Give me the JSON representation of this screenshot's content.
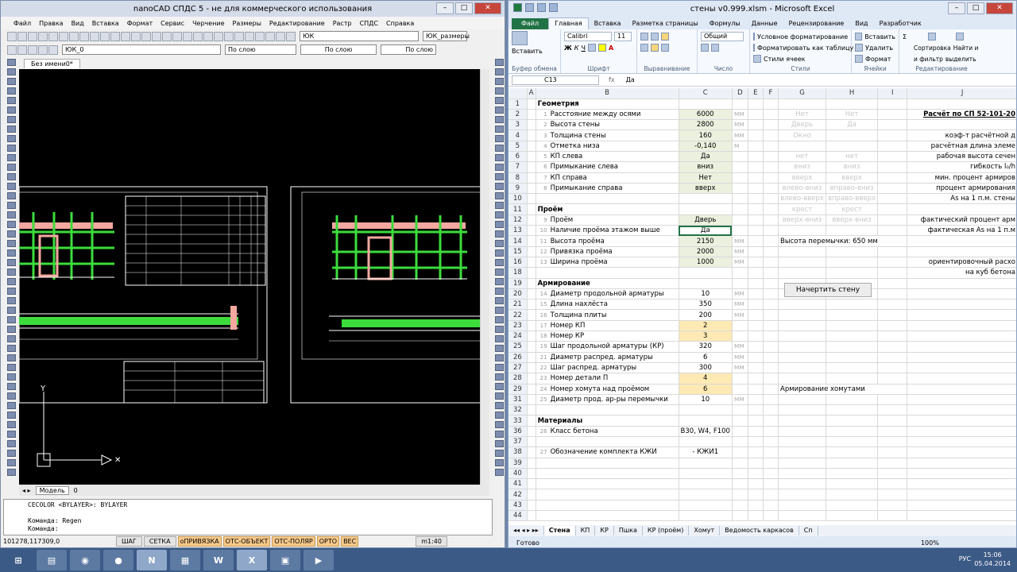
{
  "cad": {
    "title": "nanoCAD СПДС 5 - не для коммерческого использования",
    "menu": [
      "Файл",
      "Правка",
      "Вид",
      "Вставка",
      "Формат",
      "Сервис",
      "Черчение",
      "Размеры",
      "Редактирование",
      "Растр",
      "СПДС",
      "Справка"
    ],
    "combo_layer1": "ЮК",
    "combo_dim": "ЮК_размеры",
    "combo_layer2": "ЮК_0",
    "combo_color": "По слою",
    "combo_ltype": "По слою",
    "combo_lweight": "По слою",
    "doc_tab": "Без имени0*",
    "model_tab": "Модель",
    "sheet_tab": "0",
    "cmd_lines": [
      "CECOLOR <BYLAYER>: BYLAYER",
      "",
      "Команда: Regen",
      "Команда:"
    ],
    "coords": "101278,117309,0",
    "status": [
      "ШАГ",
      "СЕТКА",
      "оПРИВЯЗКА",
      "ОТС-ОБЪЕКТ",
      "ОТС-ПОЛЯР",
      "ОРТО",
      "ВЕС"
    ],
    "scale": "m1:40",
    "axis_y": "Y"
  },
  "excel": {
    "title": "стены v0.999.xlsm - Microsoft Excel",
    "tabs": [
      "Файл",
      "Главная",
      "Вставка",
      "Разметка страницы",
      "Формулы",
      "Данные",
      "Рецензирование",
      "Вид",
      "Разработчик"
    ],
    "ribbon": {
      "paste": "Вставить",
      "clipboard": "Буфер обмена",
      "font_name": "Calibri",
      "font_size": "11",
      "font": "Шрифт",
      "align": "Выравнивание",
      "numfmt": "Общий",
      "number": "Число",
      "cond": "Условное форматирование",
      "astable": "Форматировать как таблицу",
      "cellstyles": "Стили ячеек",
      "styles": "Стили",
      "ins": "Вставить",
      "del": "Удалить",
      "fmt": "Формат",
      "cells": "Ячейки",
      "sort": "Сортировка",
      "sort2": "и фильтр",
      "find": "Найти и",
      "find2": "выделить",
      "edit": "Редактирование"
    },
    "namebox": "C13",
    "fx": "fx",
    "formula": "Да",
    "cols": [
      "",
      "A",
      "B",
      "C",
      "D",
      "E",
      "F",
      "G",
      "H",
      "I",
      "J"
    ],
    "rows": [
      {
        "n": "1",
        "b": "Геометрия",
        "bb": true
      },
      {
        "n": "2",
        "s": "1",
        "b": "Расстояние между осями",
        "c": "6000",
        "cg": true,
        "d": "мм",
        "g": "Нет",
        "h": "Нет",
        "j": "Расчёт по СП 52-101-20",
        "jb": true
      },
      {
        "n": "3",
        "s": "2",
        "b": "Высота стены",
        "c": "2800",
        "cg": true,
        "d": "мм",
        "g": "Дверь",
        "h": "Да"
      },
      {
        "n": "4",
        "s": "3",
        "b": "Толщина стены",
        "c": "160",
        "cg": true,
        "d": "мм",
        "g": "Окно",
        "j": "коэф-т расчётной д"
      },
      {
        "n": "5",
        "s": "4",
        "b": "Отметка низа",
        "c": "-0,140",
        "cg": true,
        "d": "м",
        "j": "расчётная длина элеме"
      },
      {
        "n": "6",
        "s": "5",
        "b": "КП слева",
        "c": "Да",
        "cg": true,
        "g": "нет",
        "h": "нет",
        "j": "рабочая высота сечен"
      },
      {
        "n": "7",
        "s": "6",
        "b": "Примыкание слева",
        "c": "вниз",
        "cg": true,
        "g": "вниз",
        "h": "вниз",
        "j": "гибкость l₀/h"
      },
      {
        "n": "8",
        "s": "7",
        "b": "КП справа",
        "c": "Нет",
        "cg": true,
        "g": "вверх",
        "h": "вверх",
        "j": "мин. процент армиров"
      },
      {
        "n": "9",
        "s": "8",
        "b": "Примыкание справа",
        "c": "вверх",
        "cg": true,
        "g": "влево-вниз",
        "h": "вправо-вниз",
        "j": "процент армирования"
      },
      {
        "n": "10",
        "g": "влево-вверх",
        "h": "вправо-вверх",
        "j": "As на 1 п.м. стены"
      },
      {
        "n": "11",
        "b": "Проём",
        "bb": true,
        "g": "крест",
        "h": "крест"
      },
      {
        "n": "12",
        "s": "9",
        "b": "Проём",
        "c": "Дверь",
        "cg": true,
        "g": "вверх-вниз",
        "h": "вверх-вниз",
        "j": "фактический процент арм"
      },
      {
        "n": "13",
        "s": "10",
        "b": "Наличие проёма этажом выше",
        "c": "Да",
        "sel": true,
        "j": "фактическая As на 1 п.м"
      },
      {
        "n": "14",
        "s": "11",
        "b": "Высота проёма",
        "c": "2150",
        "cg": true,
        "d": "мм",
        "ga": "Высота перемычки: 650 мм"
      },
      {
        "n": "15",
        "s": "12",
        "b": "Привязка проёма",
        "c": "2000",
        "cg": true,
        "d": "мм"
      },
      {
        "n": "16",
        "s": "13",
        "b": "Ширина проёма",
        "c": "1000",
        "cg": true,
        "d": "мм",
        "j": "ориентировочный расхо"
      },
      {
        "n": "18",
        "j": "на куб бетона"
      },
      {
        "n": "19",
        "b": "Армирование",
        "bb": true
      },
      {
        "n": "20",
        "s": "14",
        "b": "Диаметр продольной арматуры",
        "c": "10",
        "d": "мм"
      },
      {
        "n": "21",
        "s": "15",
        "b": "Длина нахлёста",
        "c": "350",
        "d": "мм"
      },
      {
        "n": "22",
        "s": "16",
        "b": "Толщина плиты",
        "c": "200",
        "d": "мм"
      },
      {
        "n": "23",
        "s": "17",
        "b": "Номер КП",
        "c": "2",
        "co": true
      },
      {
        "n": "24",
        "s": "18",
        "b": "Номер КР",
        "c": "3",
        "co": true
      },
      {
        "n": "25",
        "s": "19",
        "b": "Шаг продольной арматуры (КР)",
        "c": "320",
        "d": "мм"
      },
      {
        "n": "26",
        "s": "21",
        "b": "Диаметр распред. арматуры",
        "c": "6",
        "d": "мм"
      },
      {
        "n": "27",
        "s": "22",
        "b": "Шаг распред. арматуры",
        "c": "300",
        "d": "мм"
      },
      {
        "n": "28",
        "s": "23",
        "b": "Номер детали П",
        "c": "4",
        "co": true
      },
      {
        "n": "29",
        "s": "24",
        "b": "Номер хомута над проёмом",
        "c": "6",
        "co": true,
        "ga": "Армирование хомутами"
      },
      {
        "n": "31",
        "s": "25",
        "b": "Диаметр прод. ар-ры перемычки",
        "c": "10",
        "d": "мм"
      },
      {
        "n": "32"
      },
      {
        "n": "33",
        "b": "Материалы",
        "bb": true
      },
      {
        "n": "36",
        "s": "26",
        "b": "Класс бетона",
        "c": "B30, W4, F100"
      },
      {
        "n": "37"
      },
      {
        "n": "38",
        "s": "27",
        "b": "Обозначение комплекта КЖИ",
        "c": "- КЖИ1"
      },
      {
        "n": "39"
      },
      {
        "n": "40"
      },
      {
        "n": "41"
      },
      {
        "n": "42"
      },
      {
        "n": "43"
      },
      {
        "n": "44"
      }
    ],
    "draw_button": "Начертить стену",
    "sheets": [
      "Стена",
      "КП",
      "КР",
      "Пшка",
      "КР (проём)",
      "Хомут",
      "Ведомость каркасов",
      "Сп"
    ],
    "status": "Готово",
    "zoom": "100%"
  },
  "taskbar": {
    "lang": "РУС",
    "time": "15:06",
    "date": "05.04.2014"
  }
}
